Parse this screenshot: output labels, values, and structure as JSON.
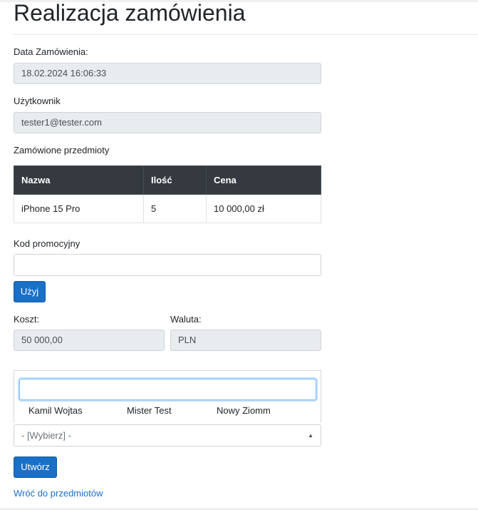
{
  "page": {
    "title": "Realizacja zamówienia"
  },
  "order": {
    "date_label": "Data Zamówienia:",
    "date_value": "18.02.2024 16:06:33",
    "user_label": "Użytkownik",
    "user_value": "tester1@tester.com",
    "items_label": "Zamówione przedmioty"
  },
  "items_table": {
    "headers": [
      "Nazwa",
      "Ilość",
      "Cena"
    ],
    "rows": [
      {
        "name": "iPhone 15 Pro",
        "qty": "5",
        "price": "10 000,00 zł"
      }
    ]
  },
  "promo": {
    "label": "Kod promocyjny",
    "value": "",
    "button": "Użyj"
  },
  "cost": {
    "label": "Koszt:",
    "value": "50 000,00"
  },
  "currency": {
    "label": "Waluta:",
    "value": "PLN"
  },
  "recipient": {
    "search_value": "",
    "options": [
      "Kamil Wojtas",
      "Mister Test",
      "Nowy Ziomm"
    ],
    "select_placeholder": "- [Wybierz] -"
  },
  "actions": {
    "create_button": "Utwórz",
    "back_link": "Wróć do przedmiotów"
  }
}
